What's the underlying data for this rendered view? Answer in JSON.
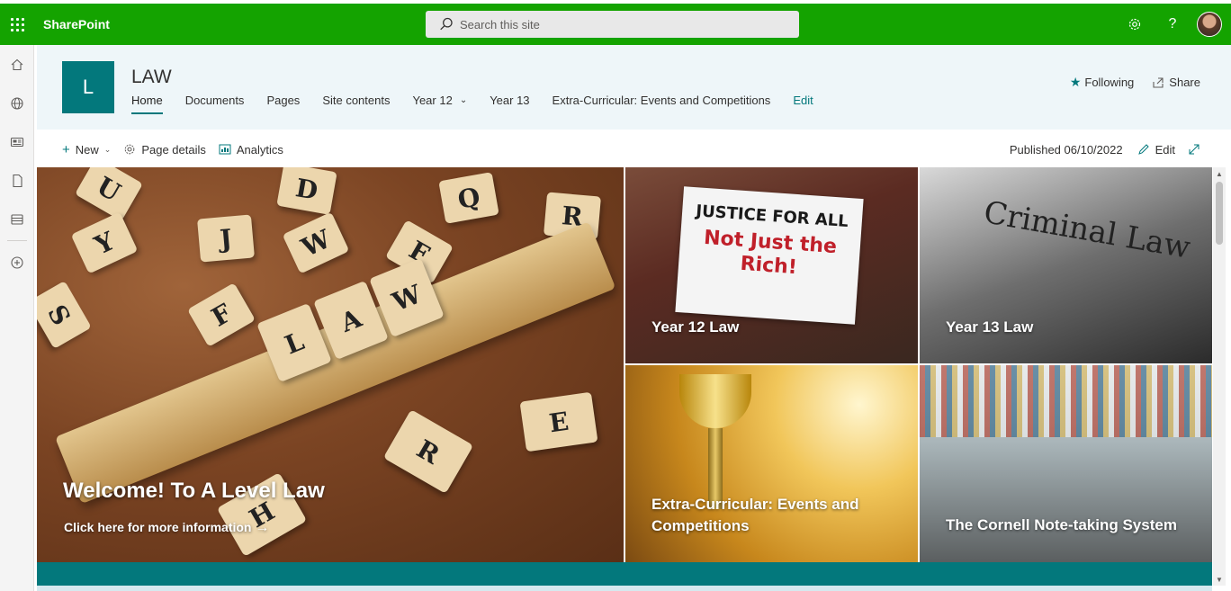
{
  "suite": {
    "brand": "SharePoint",
    "search_placeholder": "Search this site",
    "settings_icon": "gear-icon",
    "help_label": "?"
  },
  "appbar": {
    "items": [
      "home-icon",
      "globe-icon",
      "news-icon",
      "files-icon",
      "lists-icon",
      "create-icon"
    ]
  },
  "site": {
    "logo_letter": "L",
    "title": "LAW",
    "nav": [
      {
        "label": "Home"
      },
      {
        "label": "Documents"
      },
      {
        "label": "Pages"
      },
      {
        "label": "Site contents"
      },
      {
        "label": "Year 12"
      },
      {
        "label": "Year 13"
      },
      {
        "label": "Extra-Curricular: Events and Competitions"
      },
      {
        "label": "Edit"
      }
    ],
    "following_label": "Following",
    "share_label": "Share"
  },
  "commandbar": {
    "new_label": "New",
    "page_details_label": "Page details",
    "analytics_label": "Analytics",
    "published_label": "Published 06/10/2022",
    "edit_label": "Edit"
  },
  "hero": {
    "main_title": "Welcome! To A Level Law",
    "main_link": "Click here for more information",
    "main_tiles": [
      "U",
      "D",
      "Q",
      "R",
      "Y",
      "J",
      "W",
      "F",
      "S",
      "F",
      "L",
      "A",
      "W",
      "E",
      "R",
      "H"
    ],
    "tiles": [
      {
        "title": "Year 12 Law",
        "sign_line1": "JUSTICE FOR ALL",
        "sign_line2": "Not Just the Rich!"
      },
      {
        "title": "Year 13 Law",
        "paper_text": "Criminal Law"
      },
      {
        "title": "Extra-Curricular: Events and Competitions"
      },
      {
        "title": "The Cornell Note-taking System"
      }
    ]
  },
  "colors": {
    "suitebar": "#14a300",
    "theme": "#03787c",
    "header_bg": "#eef6f9"
  }
}
